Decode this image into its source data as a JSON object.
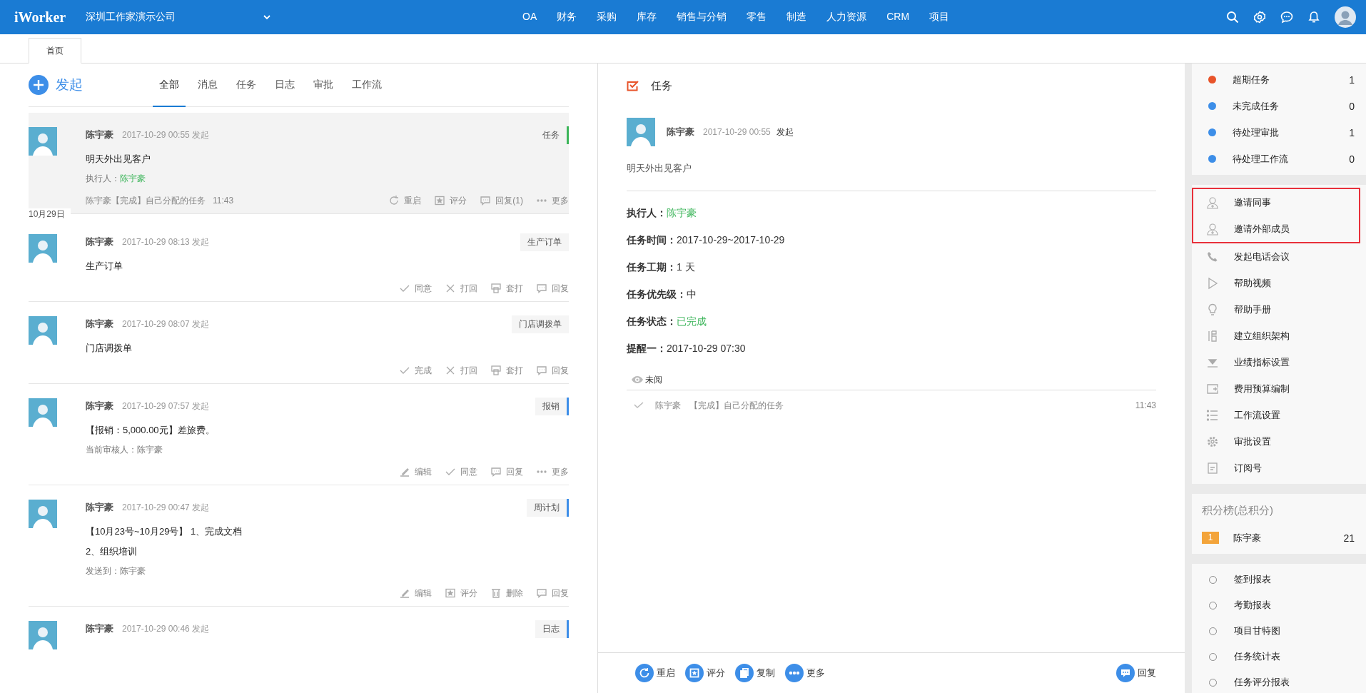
{
  "header": {
    "logo": "iWorker",
    "company": "深圳工作家演示公司",
    "nav": [
      "OA",
      "财务",
      "采购",
      "库存",
      "销售与分销",
      "零售",
      "制造",
      "人力资源",
      "CRM",
      "项目"
    ]
  },
  "page_tabs": [
    {
      "label": "首页",
      "selected": true
    }
  ],
  "compose": {
    "label": "发起"
  },
  "filter_tabs": [
    {
      "label": "全部",
      "selected": true
    },
    {
      "label": "消息",
      "selected": false
    },
    {
      "label": "任务",
      "selected": false
    },
    {
      "label": "日志",
      "selected": false
    },
    {
      "label": "审批",
      "selected": false
    },
    {
      "label": "工作流",
      "selected": false
    }
  ],
  "feed": [
    {
      "selected": true,
      "name": "陈宇豪",
      "time": "2017-10-29 00:55",
      "verb": "发起",
      "tag": "任务",
      "color": "#3cb55a",
      "lines": [
        "明天外出见客户"
      ],
      "meta": {
        "label": "执行人：",
        "value": "陈宇豪",
        "highlight": true
      },
      "log": {
        "text": "陈宇豪【完成】自己分配的任务",
        "time": "11:43"
      },
      "actions": [
        {
          "kind": "restart",
          "label": "重启"
        },
        {
          "kind": "rate",
          "label": "评分"
        },
        {
          "kind": "reply",
          "label": "回复(1)"
        },
        {
          "kind": "more",
          "label": "更多"
        }
      ],
      "date_after": "10月29日"
    },
    {
      "selected": false,
      "name": "陈宇豪",
      "time": "2017-10-29 08:13",
      "verb": "发起",
      "tag": "生产订单",
      "lines": [
        "生产订单"
      ],
      "actions": [
        {
          "kind": "check",
          "label": "同意"
        },
        {
          "kind": "cross",
          "label": "打回"
        },
        {
          "kind": "print",
          "label": "套打"
        },
        {
          "kind": "reply",
          "label": "回复"
        }
      ]
    },
    {
      "selected": false,
      "name": "陈宇豪",
      "time": "2017-10-29 08:07",
      "verb": "发起",
      "tag": "门店调拨单",
      "lines": [
        "门店调拨单"
      ],
      "actions": [
        {
          "kind": "check",
          "label": "完成"
        },
        {
          "kind": "cross",
          "label": "打回"
        },
        {
          "kind": "print",
          "label": "套打"
        },
        {
          "kind": "reply",
          "label": "回复"
        }
      ]
    },
    {
      "selected": false,
      "name": "陈宇豪",
      "time": "2017-10-29 07:57",
      "verb": "发起",
      "tag": "报销",
      "color": "#3d8ee8",
      "lines": [
        "【报销：5,000.00元】差旅费。"
      ],
      "meta": {
        "label": "当前审核人：",
        "value": "陈宇豪",
        "highlight": false
      },
      "actions": [
        {
          "kind": "edit",
          "label": "编辑"
        },
        {
          "kind": "check",
          "label": "同意"
        },
        {
          "kind": "reply",
          "label": "回复"
        },
        {
          "kind": "more",
          "label": "更多"
        }
      ]
    },
    {
      "selected": false,
      "name": "陈宇豪",
      "time": "2017-10-29 00:47",
      "verb": "发起",
      "tag": "周计划",
      "color": "#3d8ee8",
      "lines": [
        "【10月23号~10月29号】 1、完成文档",
        "2、组织培训"
      ],
      "meta": {
        "label": "发送到：",
        "value": "陈宇豪",
        "highlight": false
      },
      "actions": [
        {
          "kind": "edit",
          "label": "编辑"
        },
        {
          "kind": "rate",
          "label": "评分"
        },
        {
          "kind": "delete",
          "label": "删除"
        },
        {
          "kind": "reply",
          "label": "回复"
        }
      ]
    },
    {
      "selected": false,
      "name": "陈宇豪",
      "time": "2017-10-29 00:46",
      "verb": "发起",
      "tag": "日志",
      "color": "#3d8ee8"
    }
  ],
  "detail": {
    "title": "任务",
    "name": "陈宇豪",
    "time": "2017-10-29 00:55",
    "verb": "发起",
    "content": "明天外出见客户",
    "fields": [
      {
        "label": "执行人：",
        "value": "陈宇豪",
        "highlight": true
      },
      {
        "label": "任务时间：",
        "value": "2017-10-29~2017-10-29",
        "highlight": false
      },
      {
        "label": "任务工期：",
        "value": "1 天",
        "highlight": false
      },
      {
        "label": "任务优先级：",
        "value": "中",
        "highlight": false
      },
      {
        "label": "任务状态：",
        "value": "已完成",
        "highlight": true
      },
      {
        "label": "提醒一：",
        "value": "2017-10-29 07:30",
        "highlight": false
      }
    ],
    "read_status": "未阅",
    "log": {
      "name": "陈宇豪",
      "text": "【完成】自己分配的任务",
      "time": "11:43"
    },
    "toolbar": [
      {
        "kind": "restart",
        "label": "重启"
      },
      {
        "kind": "rate",
        "label": "评分"
      },
      {
        "kind": "copy",
        "label": "复制"
      },
      {
        "kind": "more",
        "label": "更多"
      }
    ],
    "reply": "回复"
  },
  "sidebar": {
    "stats": [
      {
        "label": "超期任务",
        "count": "1",
        "color": "#e8542a"
      },
      {
        "label": "未完成任务",
        "count": "0",
        "color": "#3d8ee8"
      },
      {
        "label": "待处理审批",
        "count": "1",
        "color": "#3d8ee8"
      },
      {
        "label": "待处理工作流",
        "count": "0",
        "color": "#3d8ee8"
      }
    ],
    "invite": {
      "highlighted": true,
      "items": [
        {
          "kind": "person",
          "label": "邀请同事"
        },
        {
          "kind": "person",
          "label": "邀请外部成员"
        }
      ]
    },
    "tools": [
      {
        "kind": "phone",
        "label": "发起电话会议"
      },
      {
        "kind": "play",
        "label": "帮助视频"
      },
      {
        "kind": "bulb",
        "label": "帮助手册"
      },
      {
        "kind": "org",
        "label": "建立组织架构"
      },
      {
        "kind": "download",
        "label": "业绩指标设置"
      },
      {
        "kind": "wallet",
        "label": "费用预算编制"
      },
      {
        "kind": "list",
        "label": "工作流设置"
      },
      {
        "kind": "gear",
        "label": "审批设置"
      },
      {
        "kind": "doc",
        "label": "订阅号"
      }
    ],
    "leaderboard": {
      "title": "积分榜(总积分)",
      "entries": [
        {
          "rank": "1",
          "name": "陈宇豪",
          "score": "21"
        }
      ]
    },
    "reports": [
      "签到报表",
      "考勤报表",
      "项目甘特图",
      "任务统计表",
      "任务评分报表"
    ]
  }
}
